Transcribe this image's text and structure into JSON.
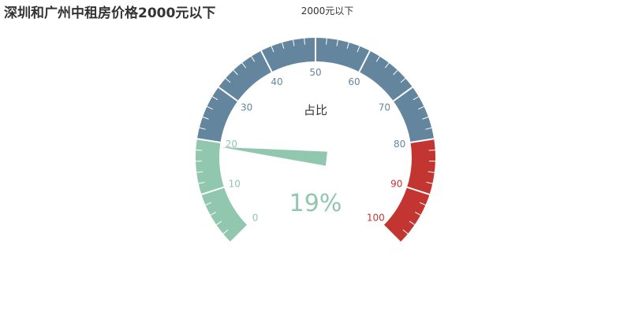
{
  "title": "深圳和广州中租房价格2000元以下",
  "legend": "2000元以下",
  "chart_data": {
    "type": "gauge",
    "series_name": "2000元以下",
    "detail_label": "占比",
    "value": 19,
    "value_text": "19%",
    "min": 0,
    "max": 100,
    "tick_labels": [
      "0",
      "10",
      "20",
      "30",
      "40",
      "50",
      "60",
      "70",
      "80",
      "90",
      "100"
    ],
    "bands": [
      {
        "to": 0.2,
        "color": "#91c7ae"
      },
      {
        "to": 0.8,
        "color": "#63869e"
      },
      {
        "to": 1.0,
        "color": "#c23531"
      }
    ]
  }
}
